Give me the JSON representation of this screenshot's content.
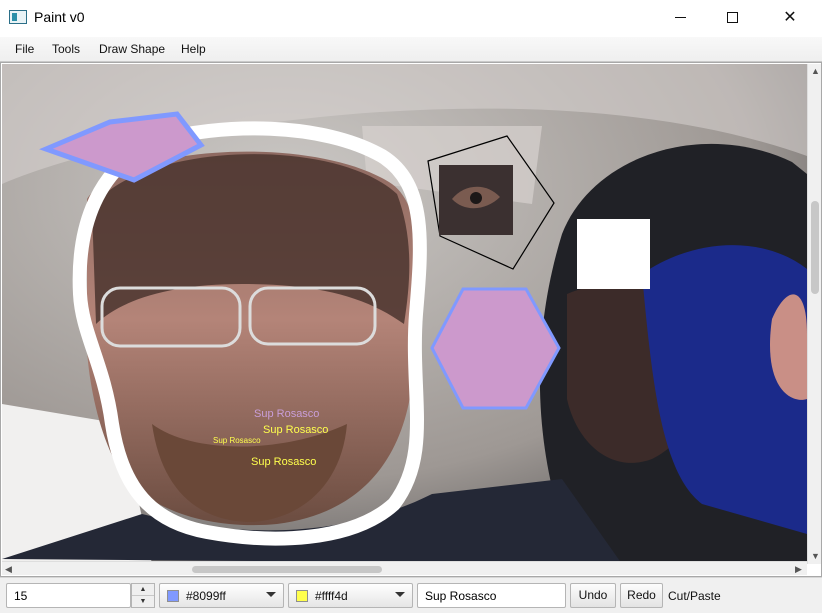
{
  "window": {
    "title": "Paint v0",
    "minimize_icon": "minimize-icon",
    "maximize_icon": "maximize-icon",
    "close_icon": "close-icon"
  },
  "menu": {
    "items": [
      "File",
      "Tools",
      "Draw Shape",
      "Help"
    ]
  },
  "canvas": {
    "text_stamps": [
      "Sup Rosasco",
      "Sup Rosasco",
      "Sup Rosasco",
      "Sup Rosasco"
    ],
    "stamp_colors": [
      "#c99ed8",
      "#ffff4d",
      "#ffff4d",
      "#ffff4d"
    ],
    "shape_fill": "#cc99cc",
    "shape_stroke": "#8099ff",
    "scrollbar_arrows": [
      "up-arrow-icon",
      "down-arrow-icon",
      "left-arrow-icon",
      "right-arrow-icon"
    ]
  },
  "toolbar": {
    "size_value": "15",
    "stroke_color": {
      "label": "#8099ff",
      "swatch": "#8099ff"
    },
    "fill_color": {
      "label": "#ffff4d",
      "swatch": "#ffff4d"
    },
    "text_value": "Sup Rosasco",
    "undo_label": "Undo",
    "redo_label": "Redo",
    "mode_label": "Cut/Paste"
  }
}
